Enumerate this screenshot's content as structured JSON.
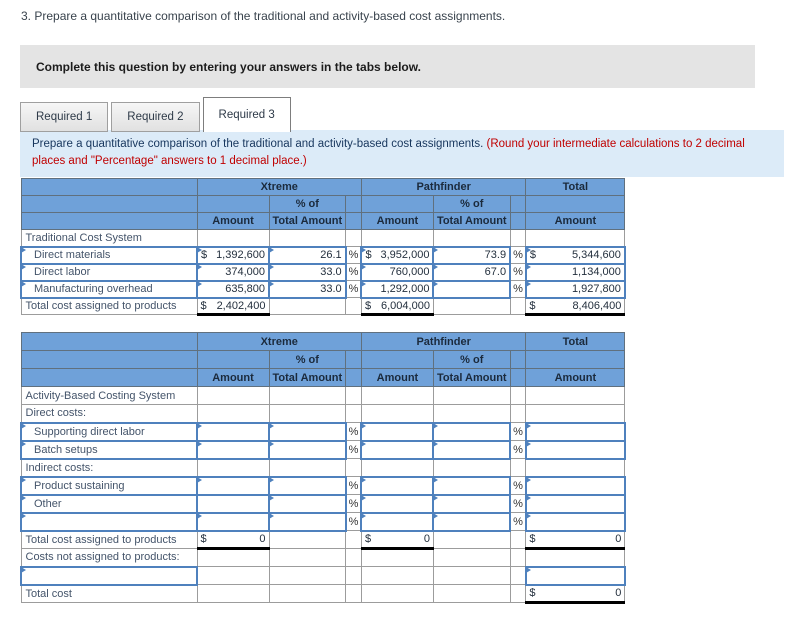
{
  "page": {
    "title": "3. Prepare a quantitative comparison of the traditional and activity-based cost assignments.",
    "banner": "Complete this question by entering your answers in the tabs below.",
    "tabs": [
      {
        "label": "Required 1",
        "active": false
      },
      {
        "label": "Required 2",
        "active": false
      },
      {
        "label": "Required 3",
        "active": true
      }
    ],
    "instruction": {
      "main": "Prepare a quantitative comparison of the traditional and activity-based cost assignments.",
      "note": "(Round your intermediate calculations to 2 decimal places and \"Percentage\" answers to 1 decimal place.)"
    }
  },
  "colors": {
    "header_bg": "#6FA1D9",
    "input_border": "#4F81BD",
    "selection_border": "#4472C4",
    "note_red": "#C00000",
    "panel_bg": "#DCEBF8",
    "banner_bg": "#E4E4E4"
  },
  "tables": [
    {
      "name": "traditional-cost-table",
      "header": {
        "groups": [
          {
            "label": "Xtreme",
            "span": 3
          },
          {
            "label": "Pathfinder",
            "span": 3
          },
          {
            "label": "Total",
            "span": 1
          }
        ],
        "subrow": [
          "",
          "",
          "% of",
          "",
          "",
          "% of",
          "",
          ""
        ],
        "colrow": [
          "",
          "Amount",
          "Total Amount",
          "",
          "Amount",
          "Total Amount",
          "",
          "Amount"
        ]
      },
      "rows": [
        {
          "label": {
            "text": "Traditional Cost System",
            "input": false,
            "indent": false
          },
          "cells": [
            {
              "type": "blank"
            },
            {
              "type": "blank"
            },
            {
              "type": "blank"
            },
            {
              "type": "blank"
            },
            {
              "type": "blank"
            },
            {
              "type": "blank"
            },
            {
              "type": "blank"
            }
          ]
        },
        {
          "label": {
            "text": "Direct materials",
            "input": true,
            "indent": true
          },
          "cells": [
            {
              "type": "input",
              "prefix": "$",
              "value": "1,392,600"
            },
            {
              "type": "input",
              "value": "26.1"
            },
            {
              "type": "sym",
              "text": "%"
            },
            {
              "type": "input",
              "prefix": "$",
              "value": "3,952,000"
            },
            {
              "type": "input",
              "value": "73.9"
            },
            {
              "type": "sym",
              "text": "%"
            },
            {
              "type": "input",
              "prefix": "$",
              "value": "5,344,600"
            }
          ]
        },
        {
          "label": {
            "text": "Direct labor",
            "input": true,
            "indent": true
          },
          "cells": [
            {
              "type": "input",
              "value": "374,000"
            },
            {
              "type": "input",
              "value": "33.0"
            },
            {
              "type": "sym",
              "text": "%"
            },
            {
              "type": "input",
              "value": "760,000"
            },
            {
              "type": "input",
              "value": "67.0"
            },
            {
              "type": "sym",
              "text": "%"
            },
            {
              "type": "input",
              "value": "1,134,000"
            }
          ]
        },
        {
          "label": {
            "text": "Manufacturing overhead",
            "input": true,
            "indent": true
          },
          "cells": [
            {
              "type": "input",
              "value": "635,800"
            },
            {
              "type": "input",
              "value": "33.0"
            },
            {
              "type": "sym",
              "text": "%"
            },
            {
              "type": "input",
              "value": "1,292,000"
            },
            {
              "type": "input",
              "value": ""
            },
            {
              "type": "sym",
              "text": "%"
            },
            {
              "type": "input",
              "value": "1,927,800"
            }
          ]
        },
        {
          "label": {
            "text": "Total cost assigned to products",
            "input": false,
            "indent": false
          },
          "cells": [
            {
              "type": "total",
              "prefix": "$",
              "value": "2,402,400"
            },
            {
              "type": "blank"
            },
            {
              "type": "blank"
            },
            {
              "type": "total",
              "prefix": "$",
              "value": "6,004,000"
            },
            {
              "type": "blank"
            },
            {
              "type": "blank"
            },
            {
              "type": "total",
              "prefix": "$",
              "value": "8,406,400"
            }
          ]
        }
      ]
    },
    {
      "name": "activity-based-costing-table",
      "header": {
        "groups": [
          {
            "label": "Xtreme",
            "span": 3
          },
          {
            "label": "Pathfinder",
            "span": 3
          },
          {
            "label": "Total",
            "span": 1
          }
        ],
        "subrow": [
          "",
          "",
          "% of",
          "",
          "",
          "% of",
          "",
          ""
        ],
        "colrow": [
          "",
          "Amount",
          "Total Amount",
          "",
          "Amount",
          "Total Amount",
          "",
          "Amount"
        ]
      },
      "rows": [
        {
          "label": {
            "text": "Activity-Based Costing System",
            "input": false,
            "indent": false
          },
          "cells": [
            {
              "type": "blank"
            },
            {
              "type": "blank"
            },
            {
              "type": "blank"
            },
            {
              "type": "blank"
            },
            {
              "type": "blank"
            },
            {
              "type": "blank"
            },
            {
              "type": "blank"
            }
          ]
        },
        {
          "label": {
            "text": "Direct costs:",
            "input": false,
            "indent": false
          },
          "cells": [
            {
              "type": "blank"
            },
            {
              "type": "blank"
            },
            {
              "type": "blank"
            },
            {
              "type": "blank"
            },
            {
              "type": "blank"
            },
            {
              "type": "blank"
            },
            {
              "type": "blank"
            }
          ]
        },
        {
          "label": {
            "text": "Supporting direct labor",
            "input": true,
            "indent": true
          },
          "cells": [
            {
              "type": "input",
              "value": ""
            },
            {
              "type": "input",
              "value": ""
            },
            {
              "type": "sym",
              "text": "%"
            },
            {
              "type": "input",
              "value": ""
            },
            {
              "type": "input",
              "value": ""
            },
            {
              "type": "sym",
              "text": "%"
            },
            {
              "type": "input",
              "value": ""
            }
          ]
        },
        {
          "label": {
            "text": "Batch setups",
            "input": true,
            "indent": true
          },
          "cells": [
            {
              "type": "input",
              "value": ""
            },
            {
              "type": "input",
              "value": ""
            },
            {
              "type": "sym",
              "text": "%"
            },
            {
              "type": "input",
              "value": ""
            },
            {
              "type": "input",
              "value": ""
            },
            {
              "type": "sym",
              "text": "%"
            },
            {
              "type": "input",
              "value": ""
            }
          ]
        },
        {
          "label": {
            "text": "Indirect costs:",
            "input": false,
            "indent": false
          },
          "cells": [
            {
              "type": "blank"
            },
            {
              "type": "blank"
            },
            {
              "type": "blank"
            },
            {
              "type": "blank"
            },
            {
              "type": "blank"
            },
            {
              "type": "blank"
            },
            {
              "type": "blank"
            }
          ]
        },
        {
          "label": {
            "text": "Product sustaining",
            "input": true,
            "indent": true
          },
          "cells": [
            {
              "type": "input",
              "value": ""
            },
            {
              "type": "input",
              "value": ""
            },
            {
              "type": "sym",
              "text": "%"
            },
            {
              "type": "input",
              "value": ""
            },
            {
              "type": "input",
              "value": ""
            },
            {
              "type": "sym",
              "text": "%"
            },
            {
              "type": "input",
              "value": ""
            }
          ]
        },
        {
          "label": {
            "text": "Other",
            "input": true,
            "indent": true
          },
          "cells": [
            {
              "type": "input",
              "value": "",
              "selected": true
            },
            {
              "type": "input",
              "value": ""
            },
            {
              "type": "sym",
              "text": "%"
            },
            {
              "type": "input",
              "value": ""
            },
            {
              "type": "input",
              "value": ""
            },
            {
              "type": "sym",
              "text": "%"
            },
            {
              "type": "input",
              "value": ""
            }
          ]
        },
        {
          "label": {
            "text": "",
            "input": true,
            "indent": false
          },
          "cells": [
            {
              "type": "input",
              "value": ""
            },
            {
              "type": "input",
              "value": ""
            },
            {
              "type": "sym",
              "text": "%"
            },
            {
              "type": "input",
              "value": ""
            },
            {
              "type": "input",
              "value": ""
            },
            {
              "type": "sym",
              "text": "%"
            },
            {
              "type": "input",
              "value": ""
            }
          ]
        },
        {
          "label": {
            "text": "Total cost assigned to products",
            "input": false,
            "indent": false
          },
          "cells": [
            {
              "type": "total",
              "prefix": "$",
              "value": "0"
            },
            {
              "type": "blank"
            },
            {
              "type": "blank"
            },
            {
              "type": "total",
              "prefix": "$",
              "value": "0"
            },
            {
              "type": "blank"
            },
            {
              "type": "blank"
            },
            {
              "type": "total",
              "prefix": "$",
              "value": "0"
            }
          ]
        },
        {
          "label": {
            "text": "Costs not assigned to products:",
            "input": false,
            "indent": false
          },
          "cells": [
            {
              "type": "blank"
            },
            {
              "type": "blank"
            },
            {
              "type": "blank"
            },
            {
              "type": "blank"
            },
            {
              "type": "blank"
            },
            {
              "type": "blank"
            },
            {
              "type": "blank"
            }
          ]
        },
        {
          "label": {
            "text": "",
            "input": true,
            "indent": false
          },
          "cells": [
            {
              "type": "blank"
            },
            {
              "type": "blank"
            },
            {
              "type": "blank"
            },
            {
              "type": "blank"
            },
            {
              "type": "blank"
            },
            {
              "type": "blank"
            },
            {
              "type": "input",
              "value": ""
            }
          ]
        },
        {
          "label": {
            "text": "Total cost",
            "input": false,
            "indent": false
          },
          "cells": [
            {
              "type": "blank"
            },
            {
              "type": "blank"
            },
            {
              "type": "blank"
            },
            {
              "type": "blank"
            },
            {
              "type": "blank"
            },
            {
              "type": "blank"
            },
            {
              "type": "total",
              "prefix": "$",
              "value": "0"
            }
          ]
        }
      ]
    }
  ]
}
